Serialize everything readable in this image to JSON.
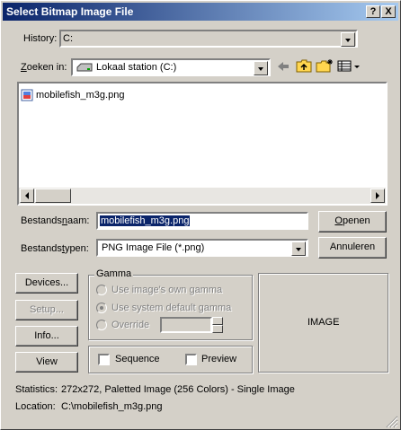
{
  "window": {
    "title": "Select Bitmap Image File",
    "help_label": "?",
    "close_label": "X"
  },
  "history": {
    "label": "History:",
    "value": "C:"
  },
  "lookin": {
    "label_prefix": "",
    "label_u": "Z",
    "label_rest": "oeken in:",
    "value": "Lokaal station (C:)"
  },
  "files": [
    {
      "name": "mobilefish_m3g.png"
    }
  ],
  "filename": {
    "label_pre": "Bestands",
    "label_u": "n",
    "label_post": "aam:",
    "value": "mobilefish_m3g.png"
  },
  "filetype": {
    "label_pre": "Bestands",
    "label_u": "t",
    "label_post": "ypen:",
    "value": "PNG Image File (*.png)"
  },
  "buttons": {
    "open_u": "O",
    "open_rest": "penen",
    "cancel": "Annuleren",
    "devices": "Devices...",
    "setup": "Setup...",
    "info": "Info...",
    "view": "View"
  },
  "gamma": {
    "title": "Gamma",
    "own": "Use image's own gamma",
    "system": "Use system default gamma",
    "override": "Override"
  },
  "options": {
    "sequence": "Sequence",
    "preview": "Preview"
  },
  "preview_label": "IMAGE",
  "statistics": {
    "label": "Statistics:",
    "value": "272x272, Paletted Image (256 Colors) - Single Image"
  },
  "location": {
    "label": "Location:",
    "value": "C:\\mobilefish_m3g.png"
  }
}
